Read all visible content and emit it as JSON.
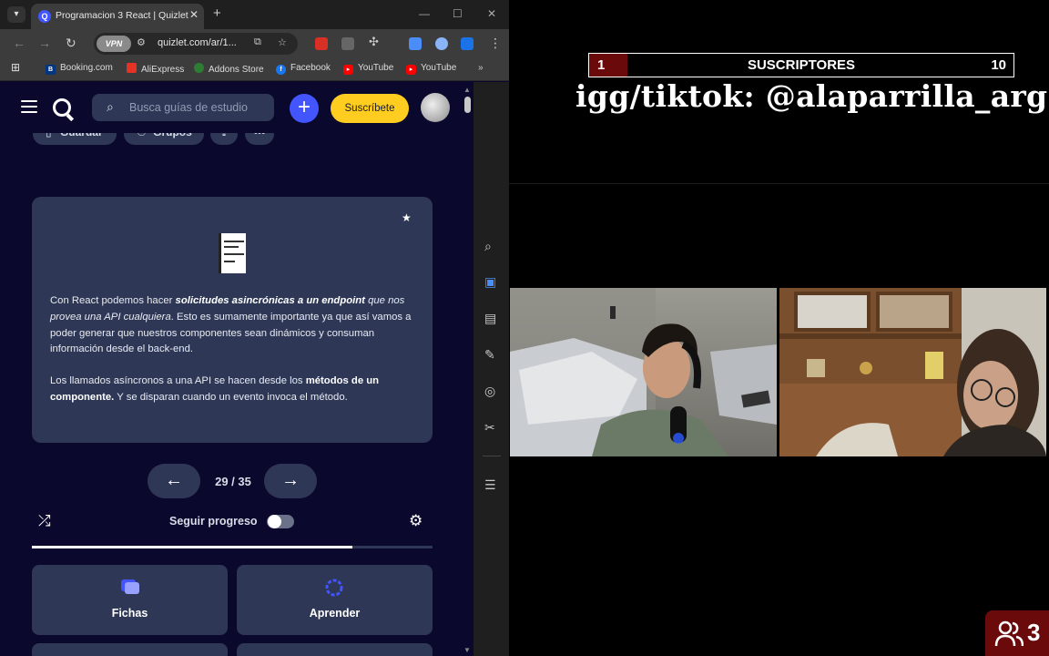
{
  "browser": {
    "tab_title": "Programacion 3 React | Quizlet",
    "url": "quizlet.com/ar/1...",
    "vpn_label": "VPN",
    "bookmarks": [
      "Booking.com",
      "AliExpress",
      "Addons Store",
      "Facebook",
      "YouTube",
      "YouTube"
    ]
  },
  "quizlet": {
    "search_placeholder": "Busca guías de estudio",
    "subscribe_label": "Suscríbete",
    "save_label": "Guardar",
    "groups_label": "Grupos",
    "card": {
      "p1_start": "Con React podemos hacer ",
      "p1_bold": "solicitudes asincrónicas a un endpoint",
      "p1_italic": " que nos provea una API cualquiera",
      "p1_end": ". Esto es sumamente importante ya que así vamos a poder generar que nuestros componentes sean dinámicos y consuman información desde el back-end.",
      "p2_start": "Los llamados asíncronos a una API se hacen desde los ",
      "p2_bold": "métodos de un componente.",
      "p2_end": " Y se disparan cuando un evento invoca el método."
    },
    "pager": "29 / 35",
    "progress_label": "Seguir progreso",
    "progress_fraction": 0.8,
    "modes": [
      "Fichas",
      "Aprender"
    ]
  },
  "stream": {
    "sub_current": "1",
    "sub_title": "SUSCRIPTORES",
    "sub_goal": "10",
    "handle": "igg/tiktok: @alaparrilla_arg",
    "viewer_count": "3"
  },
  "colors": {
    "quizlet_bg": "#0a092d",
    "card_bg": "#2e3856",
    "accent_blue": "#4255ff",
    "subscribe_yellow": "#ffcd1f",
    "overlay_red": "#6b0a0a"
  }
}
